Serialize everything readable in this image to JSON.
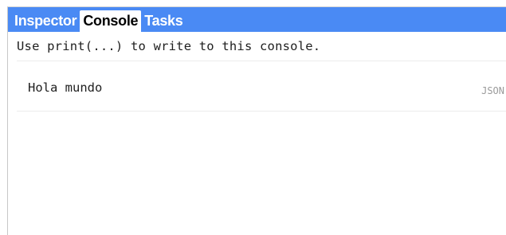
{
  "tabs": [
    {
      "label": "Inspector",
      "active": false
    },
    {
      "label": "Console",
      "active": true
    },
    {
      "label": "Tasks",
      "active": false
    }
  ],
  "colors": {
    "tabbar": "#4a8af4",
    "active_tab_bg": "#ffffff"
  },
  "console": {
    "hint": "Use print(...) to write to this console.",
    "entries": [
      {
        "text": "Hola mundo",
        "type_label": "JSON"
      }
    ]
  }
}
